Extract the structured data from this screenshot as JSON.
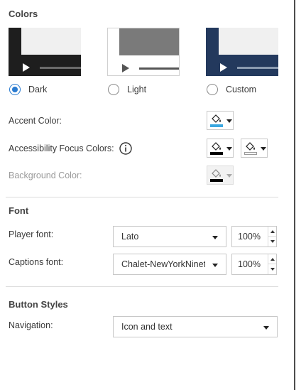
{
  "colors_section": {
    "title": "Colors",
    "themes": [
      {
        "label": "Dark",
        "selected": true
      },
      {
        "label": "Light",
        "selected": false
      },
      {
        "label": "Custom",
        "selected": false
      }
    ],
    "accent_label": "Accent Color:",
    "accent_swatch": "#3aa7e0",
    "focus_label": "Accessibility Focus Colors:",
    "focus_swatch_1": "#000000",
    "focus_swatch_2": "#ffffff",
    "background_label": "Background Color:",
    "background_swatch": "#000000"
  },
  "font_section": {
    "title": "Font",
    "player_font_label": "Player font:",
    "player_font_value": "Lato",
    "player_font_size": "100%",
    "captions_font_label": "Captions font:",
    "captions_font_value": "Chalet-NewYorkNineteenSixty",
    "captions_font_size": "100%"
  },
  "button_styles_section": {
    "title": "Button Styles",
    "navigation_label": "Navigation:",
    "navigation_value": "Icon and text"
  },
  "icons": {
    "info": "info-icon",
    "bucket": "paint-bucket-icon",
    "play": "play-icon"
  }
}
